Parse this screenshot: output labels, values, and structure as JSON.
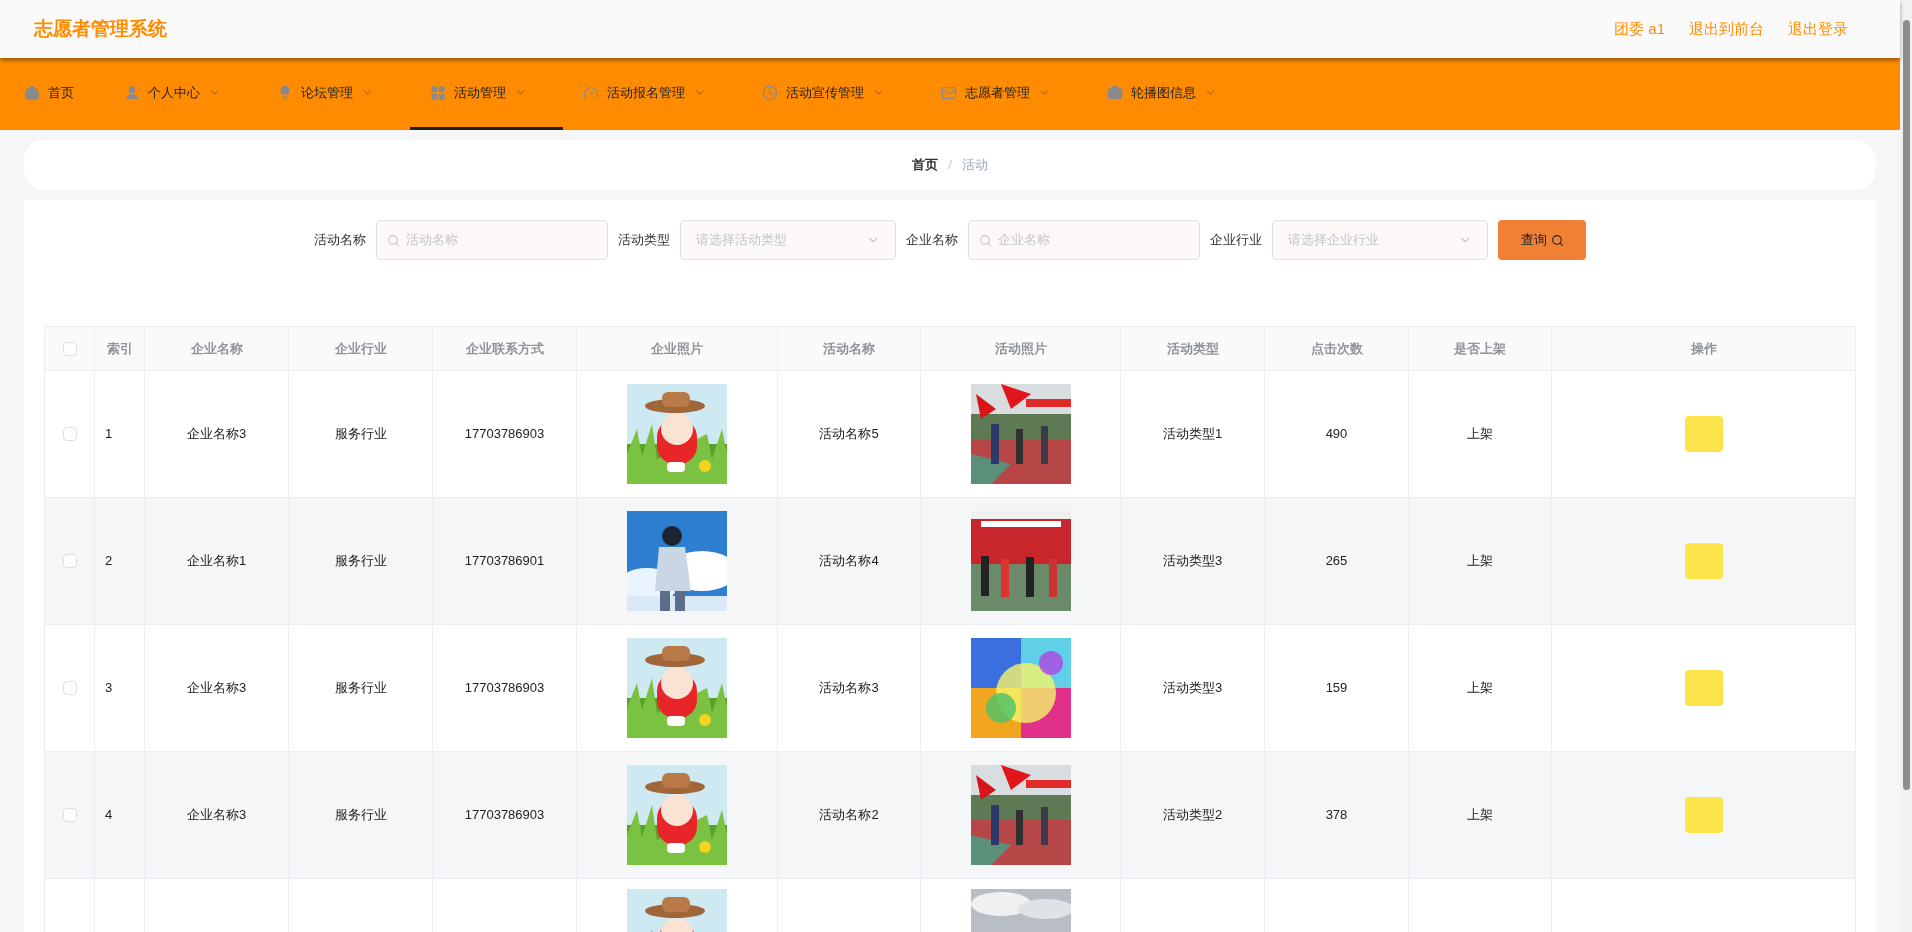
{
  "header": {
    "title": "志愿者管理系统",
    "links": [
      "团委 a1",
      "退出到前台",
      "退出登录"
    ]
  },
  "nav": [
    {
      "label": "首页",
      "dropdown": false,
      "selected": false
    },
    {
      "label": "个人中心",
      "dropdown": true,
      "selected": false
    },
    {
      "label": "论坛管理",
      "dropdown": true,
      "selected": false
    },
    {
      "label": "活动管理",
      "dropdown": true,
      "selected": true
    },
    {
      "label": "活动报名管理",
      "dropdown": true,
      "selected": false
    },
    {
      "label": "活动宣传管理",
      "dropdown": true,
      "selected": false
    },
    {
      "label": "志愿者管理",
      "dropdown": true,
      "selected": false
    },
    {
      "label": "轮播图信息",
      "dropdown": true,
      "selected": false
    }
  ],
  "breadcrumb": {
    "items": [
      "首页",
      "活动"
    ],
    "separator": "/"
  },
  "search": {
    "fields": [
      {
        "label": "活动名称",
        "kind": "text",
        "placeholder": "活动名称"
      },
      {
        "label": "活动类型",
        "kind": "select",
        "placeholder": "请选择活动类型"
      },
      {
        "label": "企业名称",
        "kind": "text",
        "placeholder": "企业名称"
      },
      {
        "label": "企业行业",
        "kind": "select",
        "placeholder": "请选择企业行业"
      }
    ],
    "button": "查询"
  },
  "table": {
    "select_all_checked": false,
    "columns": [
      "索引",
      "企业名称",
      "企业行业",
      "企业联系方式",
      "企业照片",
      "活动名称",
      "活动照片",
      "活动类型",
      "点击次数",
      "是否上架",
      "操作"
    ],
    "rows": [
      {
        "checked": false,
        "index": "1",
        "company": "企业名称3",
        "industry": "服务行业",
        "phone": "17703786903",
        "activity": "活动名称5",
        "type": "活动类型1",
        "clicks": "490",
        "listed": "上架"
      },
      {
        "checked": false,
        "index": "2",
        "company": "企业名称1",
        "industry": "服务行业",
        "phone": "17703786901",
        "activity": "活动名称4",
        "type": "活动类型3",
        "clicks": "265",
        "listed": "上架"
      },
      {
        "checked": false,
        "index": "3",
        "company": "企业名称3",
        "industry": "服务行业",
        "phone": "17703786903",
        "activity": "活动名称3",
        "type": "活动类型3",
        "clicks": "159",
        "listed": "上架"
      },
      {
        "checked": false,
        "index": "4",
        "company": "企业名称3",
        "industry": "服务行业",
        "phone": "17703786903",
        "activity": "活动名称2",
        "type": "活动类型2",
        "clicks": "378",
        "listed": "上架"
      },
      {}
    ]
  }
}
